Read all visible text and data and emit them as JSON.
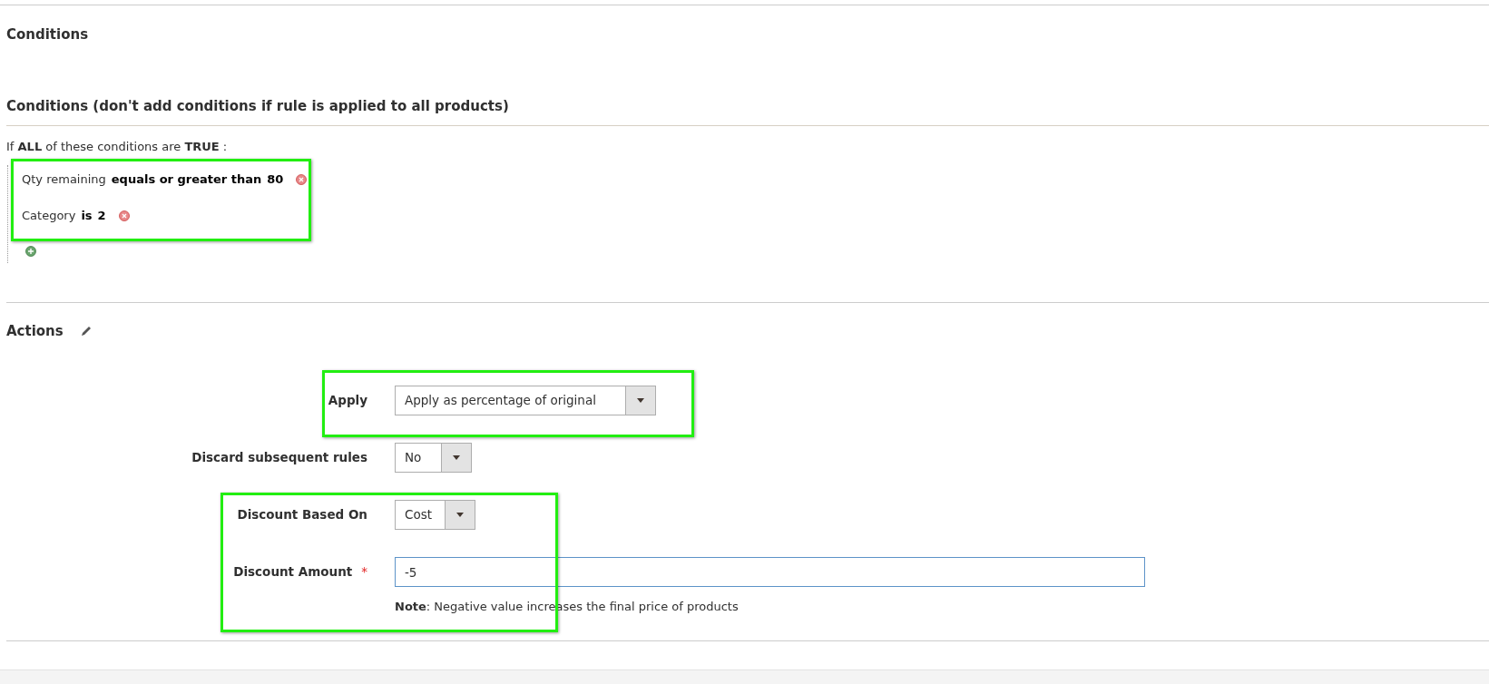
{
  "section_title": "Conditions",
  "conditions": {
    "heading": "Conditions (don't add conditions if rule is applied to all products)",
    "intro": "If **ALL**  of these conditions are **TRUE** :",
    "rules": [
      {
        "attribute": "Qty remaining",
        "operator": "equals or greater than",
        "value": "80"
      },
      {
        "attribute": "Category",
        "operator": "is",
        "value": "2"
      }
    ]
  },
  "actions": {
    "heading": "Actions",
    "fields": [
      {
        "kind": "select",
        "label": "Apply",
        "value": "Apply as percentage of original"
      },
      {
        "kind": "select",
        "label": "Discard subsequent rules",
        "value": "No"
      },
      {
        "kind": "select",
        "label": "Discount Based On",
        "value": "Cost"
      },
      {
        "kind": "input",
        "label": "Discount Amount",
        "value": "-5",
        "required_mark": "*",
        "note": "**Note**: Negative value increases the final price of products"
      }
    ]
  }
}
